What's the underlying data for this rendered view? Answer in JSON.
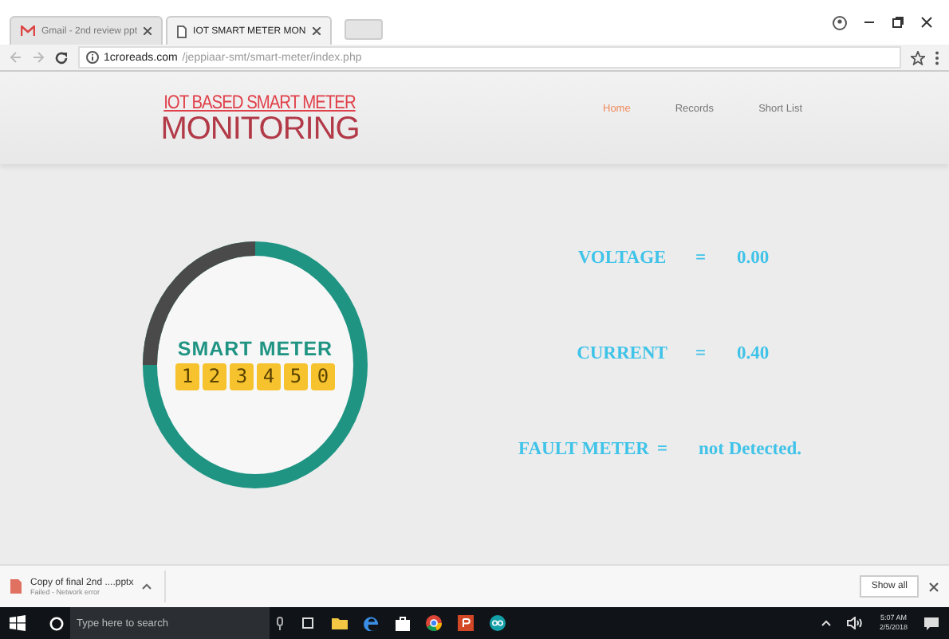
{
  "tabs": [
    {
      "title": "Gmail - 2nd review ppt",
      "selected": false,
      "kind": "mail"
    },
    {
      "title": "IOT SMART METER MON",
      "selected": true,
      "kind": "page"
    }
  ],
  "address": {
    "domain": "1croreads.com",
    "path": "/jeppiaar-smt/smart-meter/index.php"
  },
  "header": {
    "title_line1": "IOT BASED SMART METER",
    "title_line2": "MONITORING"
  },
  "nav": [
    {
      "label": "Home",
      "selected": true
    },
    {
      "label": "Records",
      "selected": false
    },
    {
      "label": "Short List",
      "selected": false
    }
  ],
  "meter_logo": {
    "label": "SMART METER",
    "digits": [
      "1",
      "2",
      "3",
      "4",
      "5",
      "0"
    ]
  },
  "readings": [
    {
      "label": "VOLTAGE",
      "sign": "=",
      "value": "0.00"
    },
    {
      "label": "CURRENT",
      "sign": "=",
      "value": "0.40"
    },
    {
      "label": "FAULT METER",
      "sign": "=",
      "value": "not Detected."
    }
  ],
  "download": {
    "file": "Copy of final 2nd ....pptx",
    "status": "Failed - Network error",
    "show_all": "Show all"
  },
  "taskbar": {
    "search_placeholder": "Type here to search",
    "time": "5:07 AM",
    "date": "2/5/2018"
  }
}
